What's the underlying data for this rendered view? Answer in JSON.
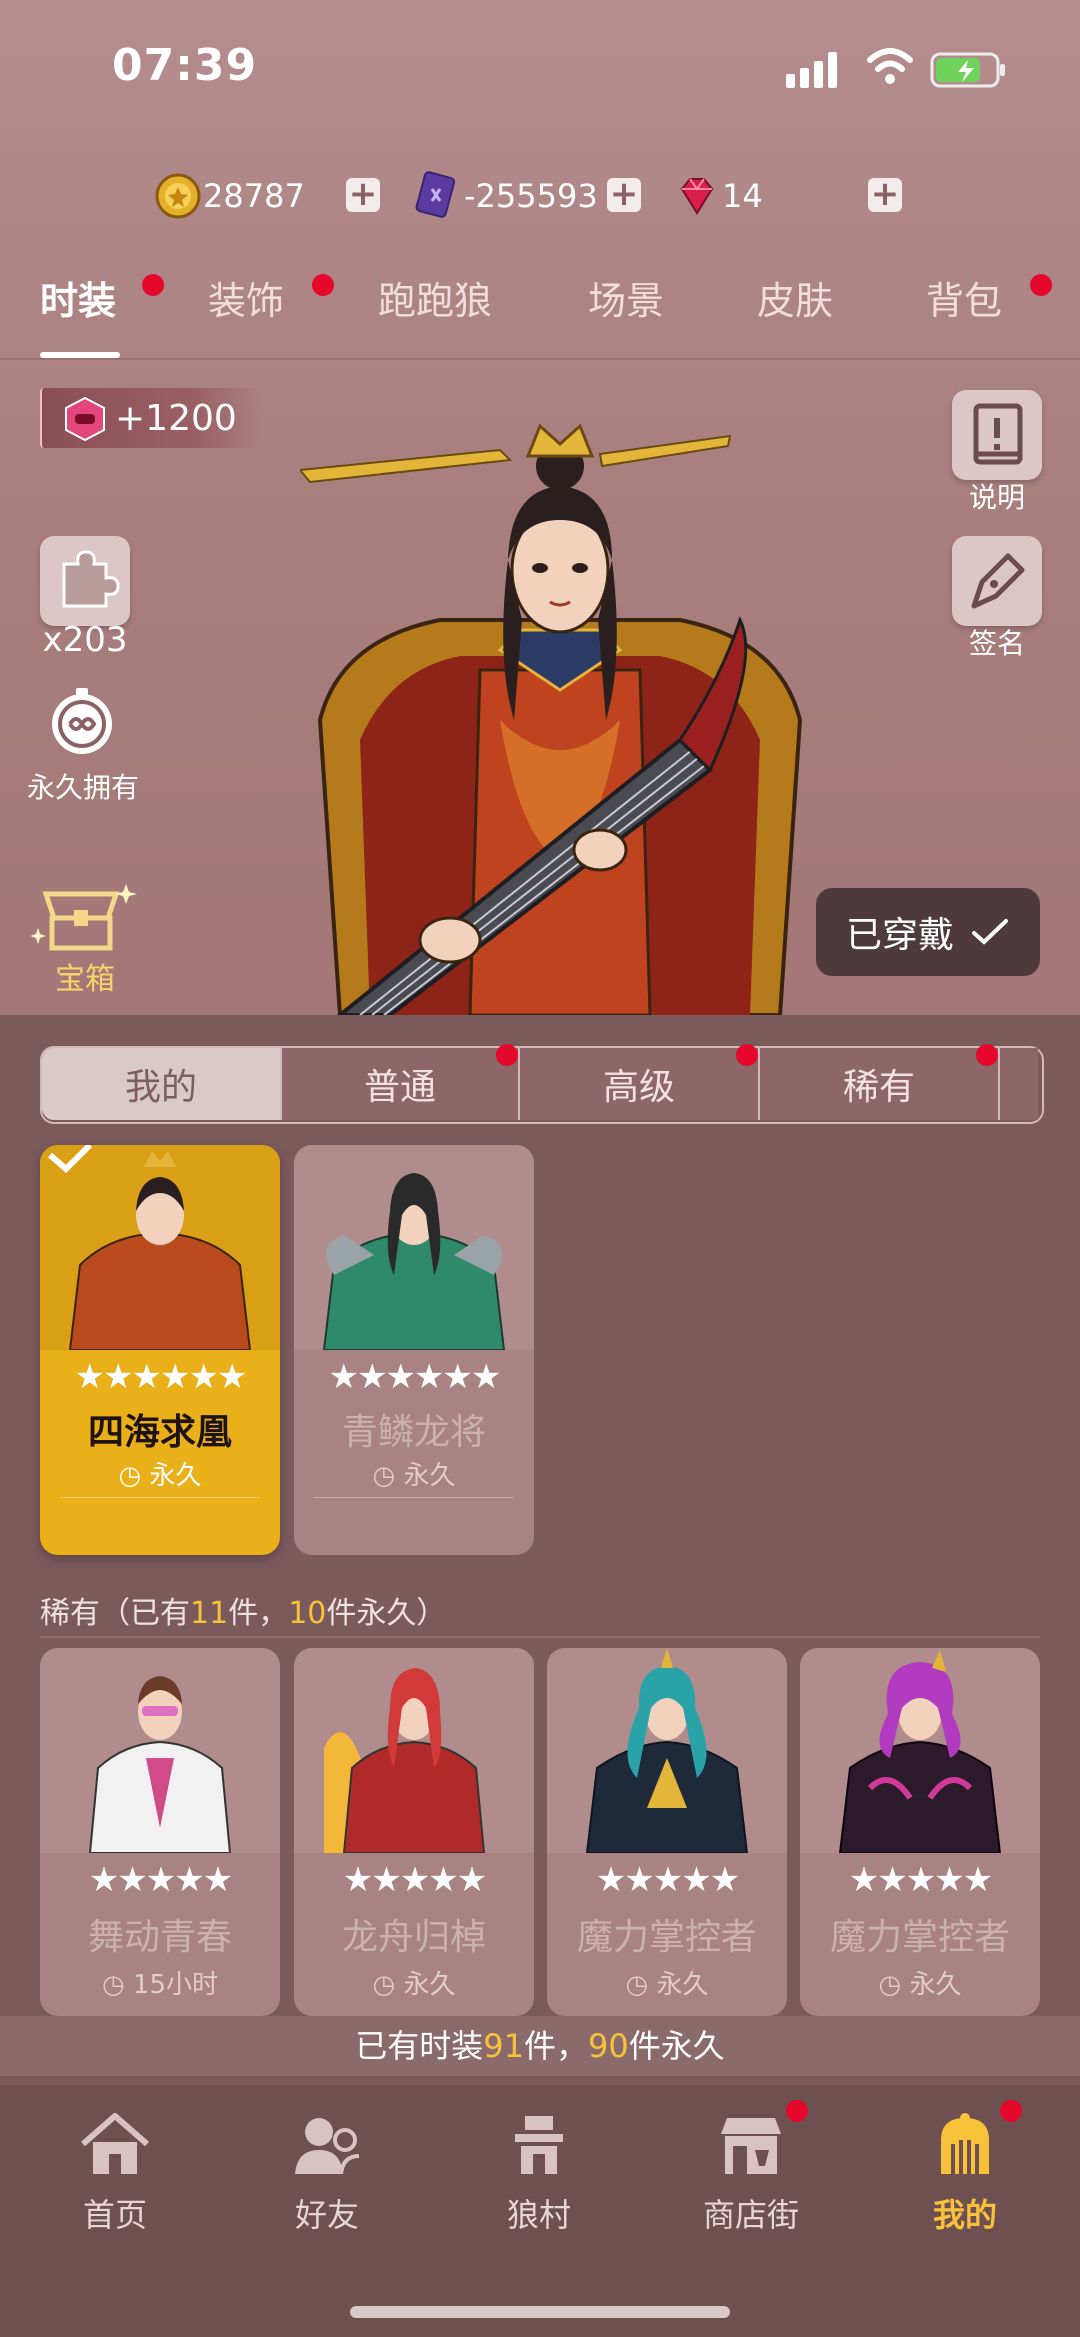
{
  "status_bar": {
    "time": "07:39"
  },
  "currencies": [
    {
      "icon": "gold-coin-icon",
      "value": "28787"
    },
    {
      "icon": "purple-card-icon",
      "value": "-255593"
    },
    {
      "icon": "red-gem-icon",
      "value": "14"
    }
  ],
  "tabs": [
    "时装",
    "装饰",
    "跑跑狼",
    "场景",
    "皮肤",
    "背包"
  ],
  "bonus": {
    "text": "+1200"
  },
  "side": {
    "puzzle_count": "x203",
    "permanent_label": "永久拥有",
    "chest_label": "宝箱",
    "help_label": "说明",
    "sign_label": "签名"
  },
  "worn_button": {
    "label": "已穿戴",
    "icon": "check-icon"
  },
  "rarity_tabs": [
    "我的",
    "普通",
    "高级",
    "稀有"
  ],
  "stars": "★★★★★★",
  "stars5": "★★★★★",
  "mine_cards": [
    {
      "name": "四海求凰",
      "duration": "永久"
    },
    {
      "name": "青鳞龙将",
      "duration": "永久"
    }
  ],
  "rare_section": {
    "prefix": "稀有（已有",
    "owned": "11",
    "mid": "件，",
    "permanent": "10",
    "suffix": "件永久）"
  },
  "rare_cards": [
    {
      "name": "舞动青春",
      "duration": "15小时"
    },
    {
      "name": "龙舟归棹",
      "duration": "永久"
    },
    {
      "name": "魔力掌控者",
      "duration": "永久"
    },
    {
      "name": "魔力掌控者",
      "duration": "永久"
    }
  ],
  "count_bar": {
    "prefix": "已有时装",
    "owned": "91",
    "mid": "件，",
    "permanent": "90",
    "suffix": "件永久"
  },
  "nav": [
    {
      "label": "首页",
      "icon": "home-icon"
    },
    {
      "label": "好友",
      "icon": "friends-icon"
    },
    {
      "label": "狼村",
      "icon": "village-icon"
    },
    {
      "label": "商店街",
      "icon": "shop-icon"
    },
    {
      "label": "我的",
      "icon": "me-icon"
    }
  ],
  "colors": {
    "accent_gold": "#f7c23a",
    "badge_red": "#e5082b",
    "panel": "#7b5a5c"
  }
}
